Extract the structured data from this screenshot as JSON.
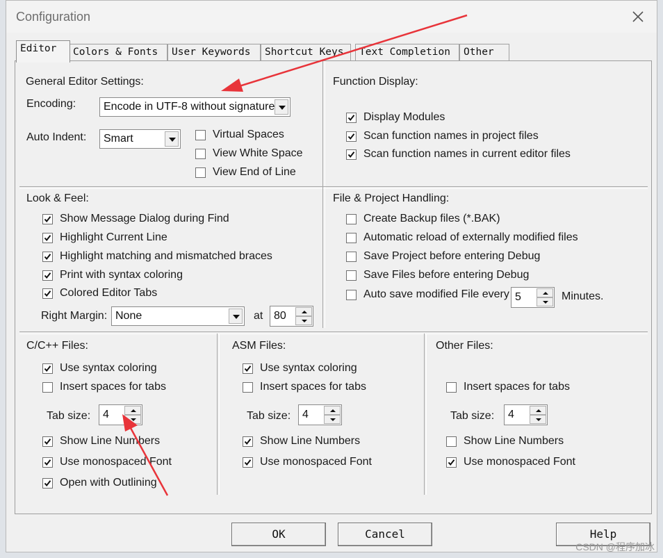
{
  "window": {
    "title": "Configuration"
  },
  "tabs": [
    "Editor",
    "Colors & Fonts",
    "User Keywords",
    "Shortcut Keys",
    "Text Completion",
    "Other"
  ],
  "general": {
    "heading": "General Editor Settings:",
    "encoding_label": "Encoding:",
    "encoding_value": "Encode in UTF-8 without signature",
    "auto_indent_label": "Auto Indent:",
    "auto_indent_value": "Smart",
    "virtual_spaces": "Virtual Spaces",
    "view_white_space": "View White Space",
    "view_end_of_line": "View End of Line"
  },
  "function_display": {
    "heading": "Function Display:",
    "items": [
      "Display Modules",
      "Scan function names in project files",
      "Scan function names in current editor files"
    ]
  },
  "look_feel": {
    "heading": "Look & Feel:",
    "items": [
      "Show Message Dialog during Find",
      "Highlight Current Line",
      "Highlight matching and mismatched braces",
      "Print with syntax coloring",
      "Colored Editor Tabs"
    ],
    "right_margin_label": "Right Margin:",
    "right_margin_value": "None",
    "at_label": "at",
    "at_value": "80"
  },
  "file_project": {
    "heading": "File & Project Handling:",
    "items": [
      "Create Backup files (*.BAK)",
      "Automatic reload of externally modified files",
      "Save Project before entering Debug",
      "Save Files before entering Debug",
      "Auto save modified File every"
    ],
    "autosave_value": "5",
    "minutes_label": "Minutes."
  },
  "c_files": {
    "heading": "C/C++ Files:",
    "use_syntax": "Use syntax coloring",
    "insert_spaces": "Insert spaces for tabs",
    "tab_size_label": "Tab size:",
    "tab_size": "4",
    "show_line_numbers": "Show Line Numbers",
    "monospaced": "Use monospaced Font",
    "outlining": "Open with Outlining"
  },
  "asm_files": {
    "heading": "ASM Files:",
    "use_syntax": "Use syntax coloring",
    "insert_spaces": "Insert spaces for tabs",
    "tab_size_label": "Tab size:",
    "tab_size": "4",
    "show_line_numbers": "Show Line Numbers",
    "monospaced": "Use monospaced Font"
  },
  "other_files": {
    "heading": "Other Files:",
    "insert_spaces": "Insert spaces for tabs",
    "tab_size_label": "Tab size:",
    "tab_size": "4",
    "show_line_numbers": "Show Line Numbers",
    "monospaced": "Use monospaced Font"
  },
  "buttons": {
    "ok": "OK",
    "cancel": "Cancel",
    "help": "Help"
  },
  "watermark": "CSDN @程序加冰",
  "colors": {
    "annotation_arrow": "#e8343a",
    "checkmark": "#111111"
  },
  "icons": {
    "close": "close-icon",
    "check": "checkmark-icon",
    "dropdown": "chevron-down-icon",
    "spin_up": "spin-up-icon",
    "spin_down": "spin-down-icon"
  }
}
